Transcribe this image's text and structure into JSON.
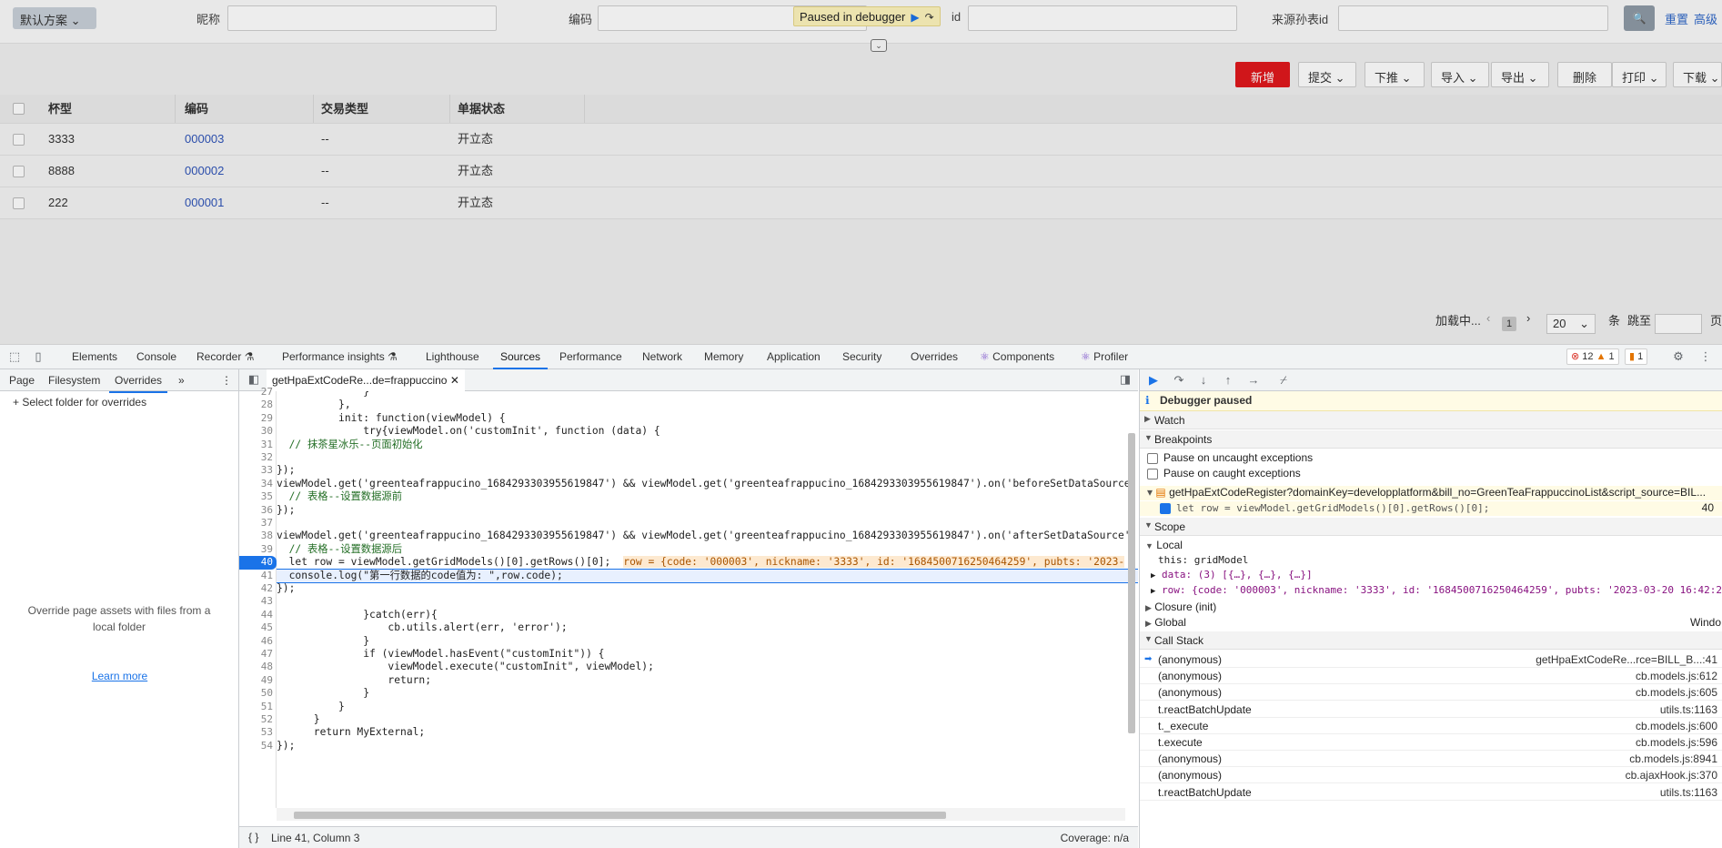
{
  "app": {
    "scheme_label": "默认方案",
    "filters": [
      {
        "label": "昵称",
        "value": ""
      },
      {
        "label": "编码",
        "value": ""
      },
      {
        "label": "id",
        "value": ""
      },
      {
        "label": "来源孙表id",
        "value": ""
      }
    ],
    "reset_label": "重置",
    "advanced_label": "高级",
    "debugger_paused_label": "Paused in debugger",
    "toolbar": {
      "add": "新增",
      "submit": "提交",
      "push": "下推",
      "import": "导入",
      "export": "导出",
      "delete": "删除",
      "print": "打印",
      "download": "下载"
    },
    "grid": {
      "headers": [
        "杯型",
        "编码",
        "交易类型",
        "单据状态"
      ],
      "rows": [
        {
          "cup": "3333",
          "code": "000003",
          "type": "--",
          "status": "开立态"
        },
        {
          "cup": "8888",
          "code": "000002",
          "type": "--",
          "status": "开立态"
        },
        {
          "cup": "222",
          "code": "000001",
          "type": "--",
          "status": "开立态"
        }
      ]
    },
    "pager": {
      "loading": "加载中...",
      "page": "1",
      "page_size": "20",
      "per_page_unit": "条",
      "jump_label": "跳至",
      "page_unit": "页"
    }
  },
  "devtools": {
    "tabs": [
      "Elements",
      "Console",
      "Recorder",
      "Performance insights",
      "Lighthouse",
      "Sources",
      "Performance",
      "Network",
      "Memory",
      "Application",
      "Security",
      "Overrides",
      "Components",
      "Profiler"
    ],
    "active_tab": "Sources",
    "error_count": "12",
    "warning_count": "1",
    "info_count": "1",
    "left_tabs": [
      "Page",
      "Filesystem",
      "Overrides"
    ],
    "select_folder": "Select folder for overrides",
    "override_message": "Override page assets with files from a local folder",
    "learn_more": "Learn more",
    "file_tab": "getHpaExtCodeRe...de=frappuccino",
    "status_line": "Line 41, Column 3",
    "coverage": "Coverage: n/a",
    "debugger_paused": "Debugger paused",
    "watch": "Watch",
    "breakpoints": "Breakpoints",
    "pause_uncaught": "Pause on uncaught exceptions",
    "pause_caught": "Pause on caught exceptions",
    "bp_file": "getHpaExtCodeRegister?domainKey=developplatform&bill_no=GreenTeaFrappuccinoList&script_source=BIL...",
    "bp_code": "let row = viewModel.getGridModels()[0].getRows()[0];",
    "bp_line": "40",
    "scope": "Scope",
    "local": "Local",
    "scope_this": "this: gridModel",
    "scope_data": "data: (3) [{…}, {…}, {…}]",
    "scope_row": "row: {code: '000003', nickname: '3333', id: '1684500716250464259', pubts: '2023-03-20 16:42:2",
    "closure": "Closure (init)",
    "global": "Global",
    "global_val": "Windo",
    "callstack": "Call Stack",
    "stack": [
      {
        "fn": "(anonymous)",
        "loc": "getHpaExtCodeRe...rce=BILL_B...:41"
      },
      {
        "fn": "(anonymous)",
        "loc": "cb.models.js:612"
      },
      {
        "fn": "(anonymous)",
        "loc": "cb.models.js:605"
      },
      {
        "fn": "t.reactBatchUpdate",
        "loc": "utils.ts:1163"
      },
      {
        "fn": "t._execute",
        "loc": "cb.models.js:600"
      },
      {
        "fn": "t.execute",
        "loc": "cb.models.js:596"
      },
      {
        "fn": "(anonymous)",
        "loc": "cb.models.js:8941"
      },
      {
        "fn": "(anonymous)",
        "loc": "cb.ajaxHook.js:370"
      },
      {
        "fn": "t.reactBatchUpdate",
        "loc": "utils.ts:1163"
      }
    ],
    "code_lines": [
      {
        "n": "27",
        "t": "              }"
      },
      {
        "n": "28",
        "t": "          },"
      },
      {
        "n": "29",
        "t": "          init: function(viewModel) {"
      },
      {
        "n": "30",
        "t": "              try{viewModel.on('customInit', function (data) {"
      },
      {
        "n": "31",
        "t": "  // 抹茶星冰乐--页面初始化"
      },
      {
        "n": "32",
        "t": ""
      },
      {
        "n": "33",
        "t": "});"
      },
      {
        "n": "34",
        "t": "viewModel.get('greenteafrappucino_1684293303955619847') && viewModel.get('greenteafrappucino_1684293303955619847').on('beforeSetDataSource', "
      },
      {
        "n": "35",
        "t": "  // 表格--设置数据源前"
      },
      {
        "n": "36",
        "t": "});"
      },
      {
        "n": "37",
        "t": ""
      },
      {
        "n": "38",
        "t": "viewModel.get('greenteafrappucino_1684293303955619847') && viewModel.get('greenteafrappucino_1684293303955619847').on('afterSetDataSource', f"
      },
      {
        "n": "39",
        "t": "  // 表格--设置数据源后"
      },
      {
        "n": "40",
        "t": "  let row = viewModel.getGridModels()[0].getRows()[0];"
      },
      {
        "n": "41",
        "t": "  console.log(\"第一行数据的code值为: \",row.code);"
      },
      {
        "n": "42",
        "t": "});"
      },
      {
        "n": "43",
        "t": ""
      },
      {
        "n": "44",
        "t": "              }catch(err){"
      },
      {
        "n": "45",
        "t": "                  cb.utils.alert(err, 'error');"
      },
      {
        "n": "46",
        "t": "              }"
      },
      {
        "n": "47",
        "t": "              if (viewModel.hasEvent(\"customInit\")) {"
      },
      {
        "n": "48",
        "t": "                  viewModel.execute(\"customInit\", viewModel);"
      },
      {
        "n": "49",
        "t": "                  return;"
      },
      {
        "n": "50",
        "t": "              }"
      },
      {
        "n": "51",
        "t": "          }"
      },
      {
        "n": "52",
        "t": "      }"
      },
      {
        "n": "53",
        "t": "      return MyExternal;"
      },
      {
        "n": "54",
        "t": "});"
      }
    ],
    "inline_value": "row = {code: '000003', nickname: '3333', id: '1684500716250464259', pubts: '2023-"
  }
}
